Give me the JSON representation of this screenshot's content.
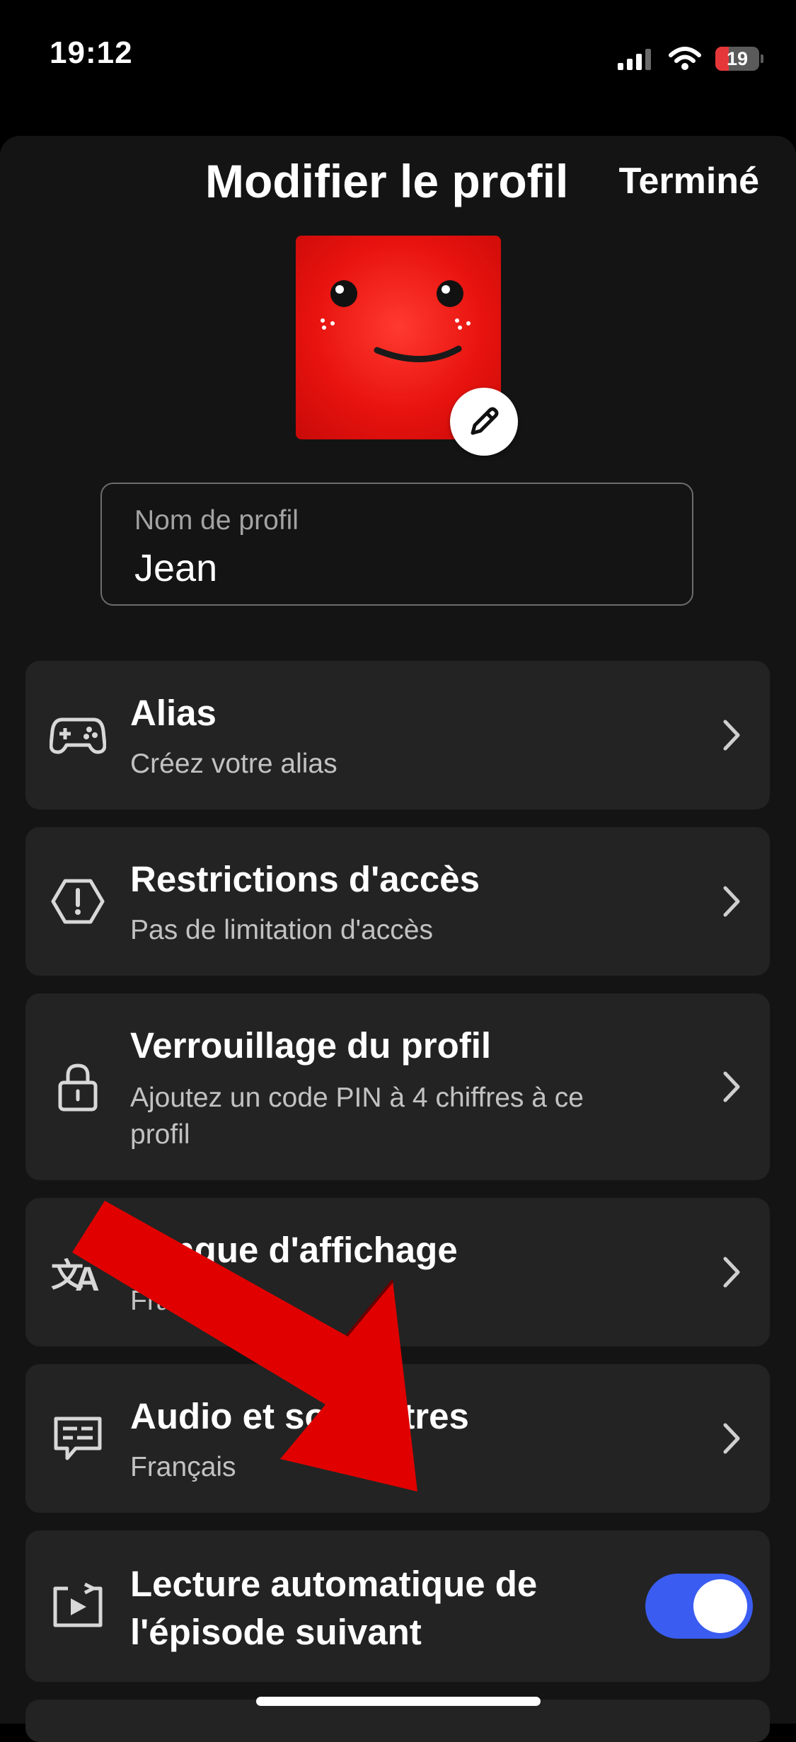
{
  "status_bar": {
    "time": "19:12",
    "battery_level": "19"
  },
  "header": {
    "title": "Modifier le profil",
    "done_label": "Terminé"
  },
  "profile_name_field": {
    "label": "Nom de profil",
    "value": "Jean"
  },
  "settings": [
    {
      "title": "Alias",
      "subtitle": "Créez votre alias",
      "icon": "gamepad-icon"
    },
    {
      "title": "Restrictions d'accès",
      "subtitle": "Pas de limitation d'accès",
      "icon": "warning-hexagon-icon"
    },
    {
      "title": "Verrouillage du profil",
      "subtitle": "Ajoutez un code PIN à 4 chiffres à ce profil",
      "icon": "lock-icon"
    },
    {
      "title": "Langue d'affichage",
      "subtitle": "Français",
      "icon": "translate-icon"
    },
    {
      "title": "Audio et sous-titres",
      "subtitle": "Français",
      "icon": "subtitles-icon"
    }
  ],
  "autoplay": {
    "title": "Lecture automatique de l'épisode suivant",
    "enabled": true,
    "icon": "autoplay-icon"
  },
  "colors": {
    "toggle_on": "#3a5cf0",
    "annotation_arrow": "#e00000",
    "avatar": "#e8130f"
  }
}
